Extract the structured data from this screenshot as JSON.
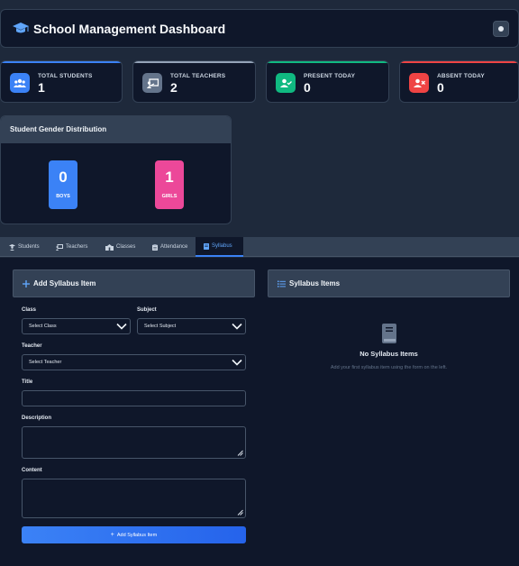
{
  "header": {
    "title": "School Management Dashboard",
    "logo_icon": "graduation-cap-icon",
    "theme_icon": "theme-toggle-icon"
  },
  "stats": [
    {
      "label": "TOTAL STUDENTS",
      "value": "1",
      "color": "#3b82f6",
      "icon": "users-icon"
    },
    {
      "label": "TOTAL TEACHERS",
      "value": "2",
      "color": "#94a3b8",
      "icon": "chalkboard-teacher-icon"
    },
    {
      "label": "PRESENT TODAY",
      "value": "0",
      "color": "#10b981",
      "icon": "user-check-icon"
    },
    {
      "label": "ABSENT TODAY",
      "value": "0",
      "color": "#ef4444",
      "icon": "user-times-icon"
    }
  ],
  "gender": {
    "title": "Student Gender Distribution",
    "boys_count": "0",
    "boys_label": "BOYS",
    "girls_count": "1",
    "girls_label": "GIRLS",
    "boys_color": "#3b82f6",
    "girls_color": "#ec4899"
  },
  "tabs": [
    {
      "label": "Students",
      "icon": "user-graduate-icon"
    },
    {
      "label": "Teachers",
      "icon": "chalkboard-icon"
    },
    {
      "label": "Classes",
      "icon": "school-icon"
    },
    {
      "label": "Attendance",
      "icon": "clipboard-icon"
    },
    {
      "label": "Syllabus",
      "icon": "book-icon",
      "active": true
    }
  ],
  "form": {
    "title": "Add Syllabus Item",
    "class_label": "Class",
    "class_value": "Select Class",
    "subject_label": "Subject",
    "subject_value": "Select Subject",
    "teacher_label": "Teacher",
    "teacher_value": "Select Teacher",
    "title_label": "Title",
    "title_value": "",
    "description_label": "Description",
    "description_value": "",
    "content_label": "Content",
    "content_value": "",
    "submit_label": "Add Syllabus Item"
  },
  "items_panel": {
    "title": "Syllabus Items",
    "empty_title": "No Syllabus Items",
    "empty_text": "Add your first syllabus item using the form on the left."
  }
}
